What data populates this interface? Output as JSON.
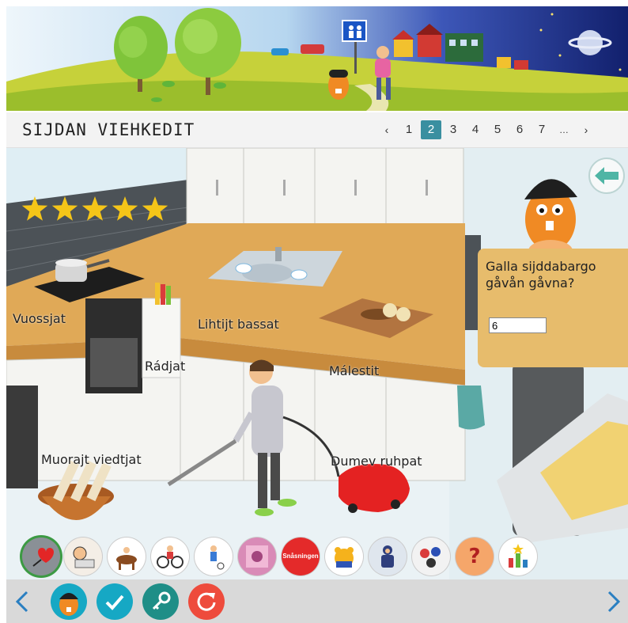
{
  "page": {
    "title": "SIJDAN VIEHKEDIT",
    "pagination": {
      "prev": "‹",
      "pages": [
        "1",
        "2",
        "3",
        "4",
        "5",
        "6",
        "7"
      ],
      "ellipsis": "…",
      "next": "›",
      "current": "2"
    }
  },
  "scene": {
    "rating": {
      "stars": 5,
      "max": 5,
      "color": "#f5c518"
    },
    "labels": {
      "stove": "Vuossjat",
      "shelf": "Rádjat",
      "sink": "Lihtijt bassat",
      "cutting_board": "Málestit",
      "firewood": "Muorajt viedtjat",
      "vacuum": "Dumev ruhpat"
    },
    "question": {
      "text": "Galla sijddabargo gåvån gåvna?",
      "answer": "6"
    },
    "back_icon": "arrow-left-icon",
    "activity_icons": [
      "heart-pin-icon",
      "sleeping-man-icon",
      "horse-rider-icon",
      "cyclist-icon",
      "soccer-player-icon",
      "book-cover-icon",
      "snasningen-icon",
      "bear-icon",
      "winter-child-icon",
      "family-scene-icon",
      "question-mark-icon",
      "bar-chart-icon"
    ],
    "snasningen_label": "Snåsningen"
  },
  "bottom_bar": {
    "prev_icon": "chevron-left-icon",
    "next_icon": "chevron-right-icon",
    "buttons": [
      "avatar-button",
      "check-button",
      "key-button",
      "refresh-button"
    ]
  },
  "colors": {
    "accent": "#3a8fa0",
    "teal_button": "#16a8c4",
    "dark_teal_button": "#1f8e87",
    "refresh": "#ee4b3c",
    "nav_arrow": "#2a7fc1",
    "question_bg": "#e7bc6c"
  }
}
